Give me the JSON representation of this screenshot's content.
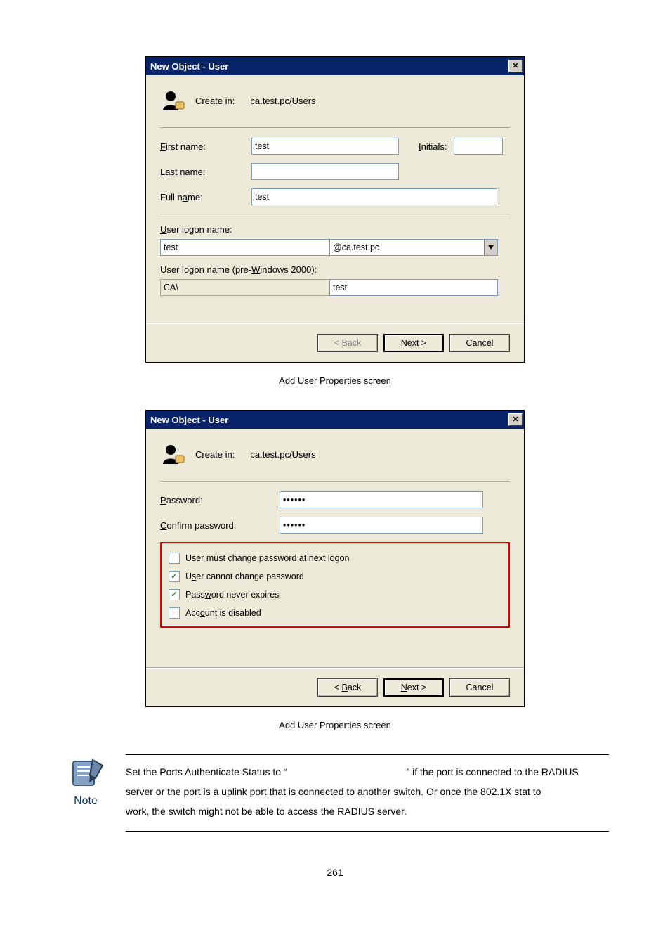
{
  "dialog1": {
    "title": "New Object - User",
    "create_in_label": "Create in:",
    "create_in_value": "ca.test.pc/Users",
    "fields": {
      "first_name_label_pre": "F",
      "first_name_label": "irst name:",
      "first_name_value": "test",
      "initials_label_pre": "I",
      "initials_label": "nitials:",
      "initials_value": "",
      "last_name_label_pre": "L",
      "last_name_label": "ast name:",
      "last_name_value": "",
      "full_name_label": "Full n",
      "full_name_label_u": "a",
      "full_name_label_post": "me:",
      "full_name_value": "test",
      "uln_label_pre": "U",
      "uln_label": "ser logon name:",
      "uln_value": "test",
      "uln_domain": "@ca.test.pc",
      "prewin_label_pre": "User logon name (pre-",
      "prewin_label_u": "W",
      "prewin_label_post": "indows 2000):",
      "prewin_domain": "CA\\",
      "prewin_value": "test"
    },
    "buttons": {
      "back": "< Back",
      "next": "Next >",
      "cancel": "Cancel",
      "back_u": "B",
      "next_u": "N"
    }
  },
  "caption1": "Add User Properties screen",
  "dialog2": {
    "title": "New Object - User",
    "create_in_label": "Create in:",
    "create_in_value": "ca.test.pc/Users",
    "pwd_label_pre": "P",
    "pwd_label": "assword:",
    "cpw_label_pre": "C",
    "cpw_label": "onfirm password:",
    "pwd_value": "••••••",
    "cpw_value": "••••••",
    "opts": {
      "o1_pre": "User ",
      "o1_u": "m",
      "o1_post": "ust change password at next logon",
      "o2_pre": "U",
      "o2_u": "s",
      "o2_post": "er cannot change password",
      "o3_pre": "Pass",
      "o3_u": "w",
      "o3_post": "ord never expires",
      "o4_pre": "Acc",
      "o4_u": "o",
      "o4_post": "unt is disabled"
    },
    "buttons": {
      "back": "< Back",
      "next": "Next >",
      "cancel": "Cancel",
      "back_u": "B",
      "next_u": "N"
    }
  },
  "caption2": "Add User Properties screen",
  "note": {
    "label": "Note",
    "line1a": "Set the Ports Authenticate Status to “",
    "line1b": "” if the port is connected to the RADIUS",
    "line2": "server or the port is a uplink port that is connected to another switch. Or once the 802.1X stat to",
    "line3": "work, the switch might not be able to access the RADIUS server."
  },
  "page_number": "261"
}
